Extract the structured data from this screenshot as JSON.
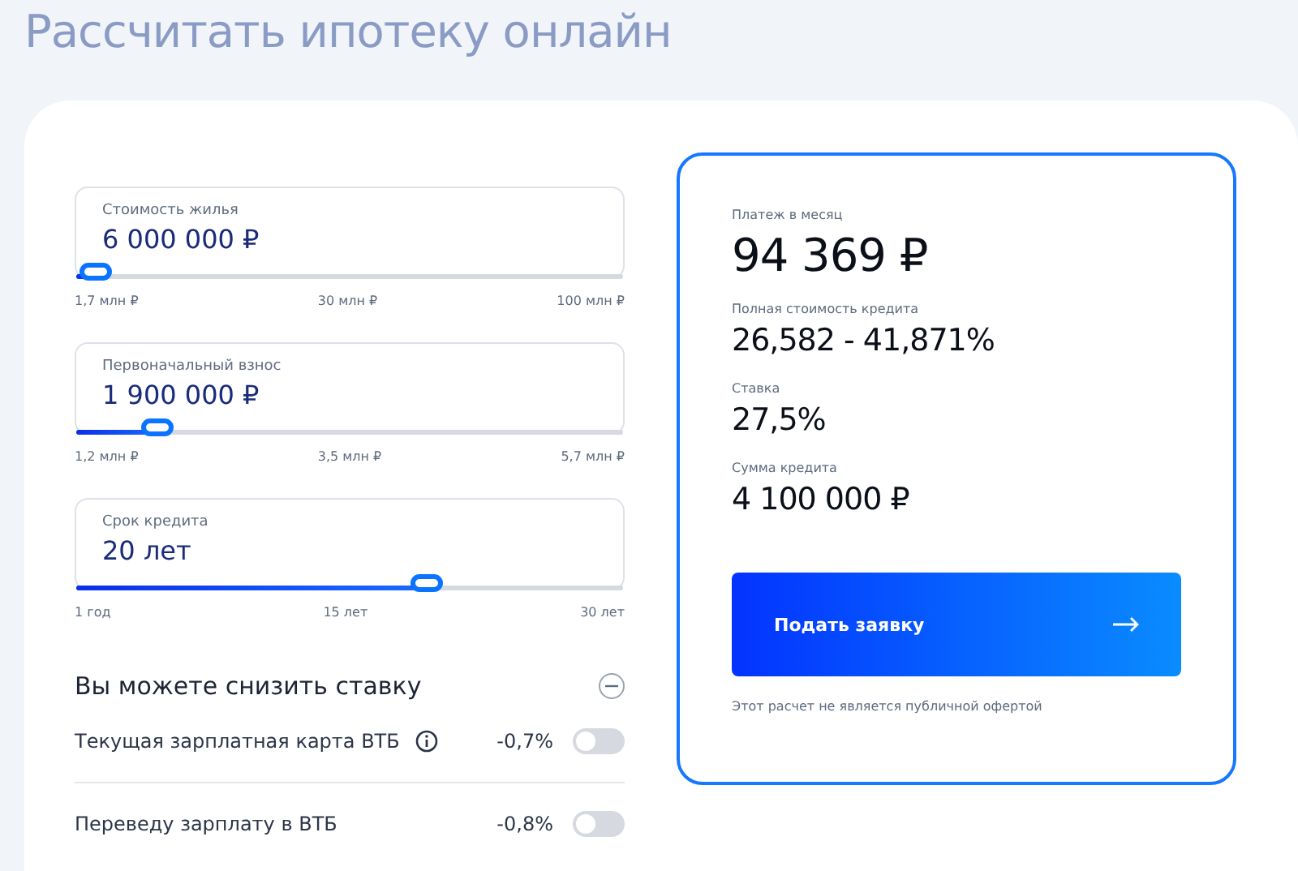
{
  "title": "Рассчитать ипотеку онлайн",
  "sliders": [
    {
      "label": "Стоимость жилья",
      "value": "6 000 000 ₽",
      "level": 0.045,
      "ticks": [
        "1,7 млн ₽",
        "30 млн ₽",
        "100 млн ₽"
      ]
    },
    {
      "label": "Первоначальный взнос",
      "value": "1 900 000 ₽",
      "level": 0.156,
      "ticks": [
        "1,2 млн ₽",
        "3,5 млн ₽",
        "5,7 млн ₽"
      ]
    },
    {
      "label": "Срок кредита",
      "value": "20 лет",
      "level": 0.65,
      "ticks": [
        "1 год",
        "15 лет",
        "30 лет"
      ]
    }
  ],
  "discounts": {
    "title": "Вы можете снизить ставку",
    "expanded": true,
    "items": [
      {
        "label": "Текущая зарплатная карта ВТБ",
        "kind": "with-info",
        "amount": "-0,7%",
        "on": false
      },
      {
        "label": "Переведу зарплату в ВТБ",
        "kind": "plain",
        "amount": "-0,8%",
        "on": false
      }
    ]
  },
  "result": {
    "stats": [
      {
        "label": "Платеж в месяц",
        "value": "94 369 ₽",
        "kind": "big"
      },
      {
        "label": "Полная стоимость кредита",
        "value": "26,582 - 41,871%",
        "kind": "normal"
      },
      {
        "label": "Ставка",
        "value": "27,5%",
        "kind": "normal"
      },
      {
        "label": "Сумма кредита",
        "value": "4 100 000 ₽",
        "kind": "normal"
      }
    ],
    "button": "Подать заявку",
    "note": "Этот расчет не является публичной офертой"
  }
}
